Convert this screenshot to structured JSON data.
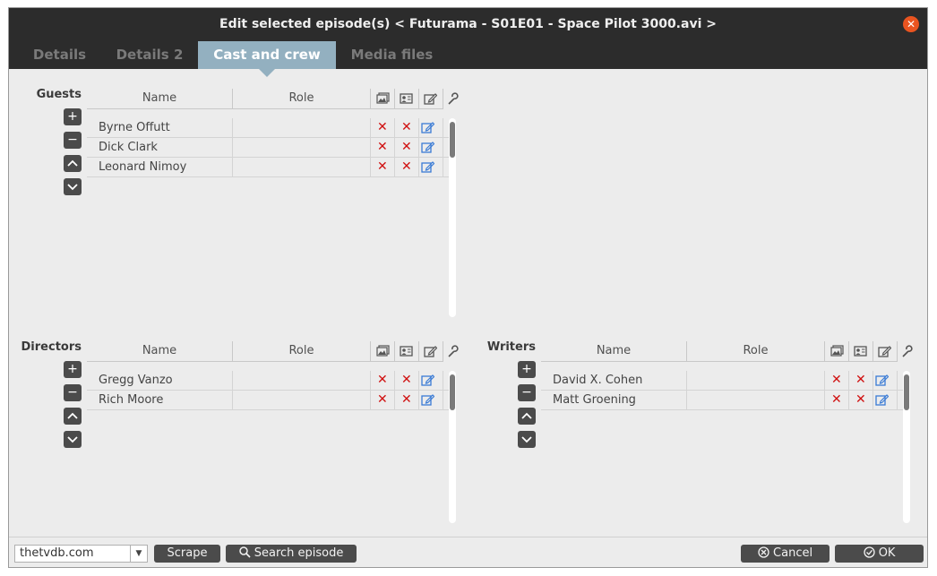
{
  "window": {
    "title": "Edit selected episode(s)  < Futurama - S01E01 - Space Pilot 3000.avi >",
    "close_symbol": "✕"
  },
  "tabs": [
    {
      "label": "Details",
      "active": false
    },
    {
      "label": "Details 2",
      "active": false
    },
    {
      "label": "Cast and crew",
      "active": true
    },
    {
      "label": "Media files",
      "active": false
    }
  ],
  "columns": {
    "name": "Name",
    "role": "Role"
  },
  "guests": {
    "label": "Guests",
    "rows": [
      {
        "name": "Byrne Offutt",
        "role": ""
      },
      {
        "name": "Dick Clark",
        "role": ""
      },
      {
        "name": "Leonard Nimoy",
        "role": ""
      }
    ]
  },
  "directors": {
    "label": "Directors",
    "rows": [
      {
        "name": "Gregg Vanzo",
        "role": ""
      },
      {
        "name": "Rich Moore",
        "role": ""
      }
    ]
  },
  "writers": {
    "label": "Writers",
    "rows": [
      {
        "name": "David X. Cohen",
        "role": ""
      },
      {
        "name": "Matt Groening",
        "role": ""
      }
    ]
  },
  "symbols": {
    "add": "+",
    "remove": "−",
    "up": "⌃",
    "down": "⌄",
    "delete": "✕"
  },
  "bottom": {
    "scraper_value": "thetvdb.com",
    "scrape_label": "Scrape",
    "search_label": "Search episode",
    "cancel_label": "Cancel",
    "ok_label": "OK"
  },
  "colors": {
    "accent": "#93b0c0",
    "close": "#e95420",
    "delete": "#d01010",
    "edit": "#3a7bd5"
  },
  "icons": [
    "image-icon",
    "id-card-icon",
    "edit-icon",
    "wrench-icon",
    "search-icon",
    "cancel-icon",
    "ok-icon",
    "dropdown-arrow-icon"
  ]
}
